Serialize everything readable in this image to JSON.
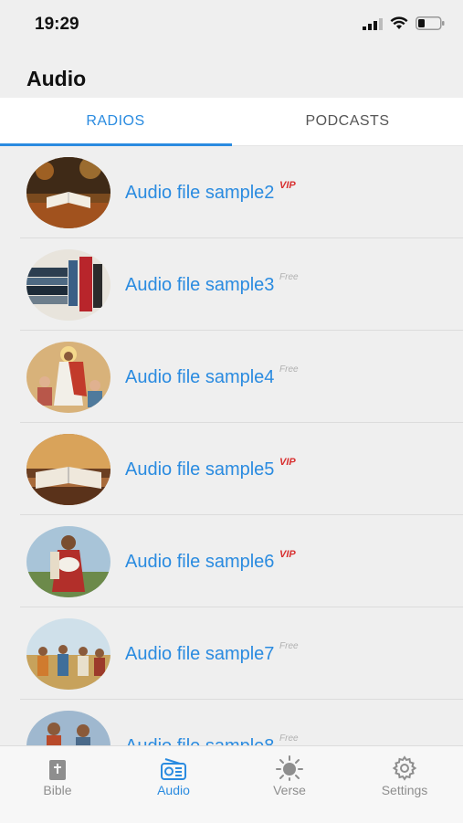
{
  "status": {
    "time": "19:29"
  },
  "header": {
    "title": "Audio"
  },
  "tabs": [
    {
      "label": "RADIOS",
      "active": true
    },
    {
      "label": "PODCASTS",
      "active": false
    }
  ],
  "items": [
    {
      "title": "Audio file sample2",
      "badge": "VIP",
      "thumb": "open-bible-autumn"
    },
    {
      "title": "Audio file sample3",
      "badge": "Free",
      "thumb": "bible-books"
    },
    {
      "title": "Audio file sample4",
      "badge": "Free",
      "thumb": "jesus-with-children"
    },
    {
      "title": "Audio file sample5",
      "badge": "VIP",
      "thumb": "open-bible-sunset"
    },
    {
      "title": "Audio file sample6",
      "badge": "VIP",
      "thumb": "good-shepherd"
    },
    {
      "title": "Audio file sample7",
      "badge": "Free",
      "thumb": "crowd-scene"
    },
    {
      "title": "Audio file sample8",
      "badge": "Free",
      "thumb": "preacher-scene"
    }
  ],
  "tabbar": [
    {
      "label": "Bible",
      "icon": "bible-icon",
      "active": false
    },
    {
      "label": "Audio",
      "icon": "radio-icon",
      "active": true
    },
    {
      "label": "Verse",
      "icon": "sun-icon",
      "active": false
    },
    {
      "label": "Settings",
      "icon": "gear-icon",
      "active": false
    }
  ],
  "colors": {
    "accent": "#2a8be0",
    "vip": "#d82f2f",
    "free": "#b0b0b0"
  }
}
